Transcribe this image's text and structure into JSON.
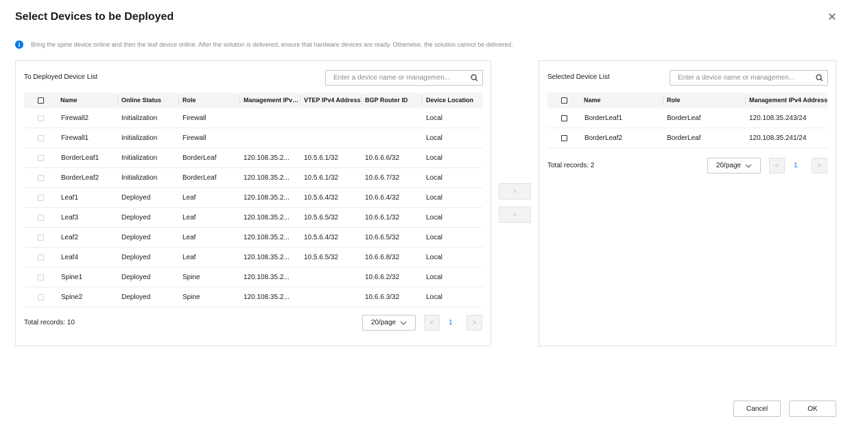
{
  "dialog": {
    "title": "Select Devices to be Deployed",
    "info_text": "Bring the spine device online and then the leaf device online. After the solution is delivered, ensure that hardware devices are ready. Otherwise, the solution cannot be delivered."
  },
  "left_panel": {
    "title": "To Deployed Device List",
    "search_placeholder": "Enter a device name or managemen...",
    "columns": [
      "Name",
      "Online Status",
      "Role",
      "Management IPv4...",
      "VTEP IPv4 Address",
      "BGP Router ID",
      "Device Location"
    ],
    "rows": [
      [
        "Firewall2",
        "Initialization",
        "Firewall",
        "",
        "",
        "",
        "Local"
      ],
      [
        "Firewall1",
        "Initialization",
        "Firewall",
        "",
        "",
        "",
        "Local"
      ],
      [
        "BorderLeaf1",
        "Initialization",
        "BorderLeaf",
        "120.108.35.2...",
        "10.5.6.1/32",
        "10.6.6.6/32",
        "Local"
      ],
      [
        "BorderLeaf2",
        "Initialization",
        "BorderLeaf",
        "120.108.35.2...",
        "10.5.6.1/32",
        "10.6.6.7/32",
        "Local"
      ],
      [
        "Leaf1",
        "Deployed",
        "Leaf",
        "120.108.35.2...",
        "10.5.6.4/32",
        "10.6.6.4/32",
        "Local"
      ],
      [
        "Leaf3",
        "Deployed",
        "Leaf",
        "120.108.35.2...",
        "10.5.6.5/32",
        "10.6.6.1/32",
        "Local"
      ],
      [
        "Leaf2",
        "Deployed",
        "Leaf",
        "120.108.35.2...",
        "10.5.6.4/32",
        "10.6.6.5/32",
        "Local"
      ],
      [
        "Leaf4",
        "Deployed",
        "Leaf",
        "120.108.35.2...",
        "10.5.6.5/32",
        "10.6.6.8/32",
        "Local"
      ],
      [
        "Spine1",
        "Deployed",
        "Spine",
        "120.108.35.2...",
        "",
        "10.6.6.2/32",
        "Local"
      ],
      [
        "Spine2",
        "Deployed",
        "Spine",
        "120.108.35.2...",
        "",
        "10.6.6.3/32",
        "Local"
      ]
    ],
    "total_records": "Total records: 10",
    "page_size": "20/page",
    "current_page": "1"
  },
  "transfer": {
    "to_right": ">",
    "to_left": "<"
  },
  "right_panel": {
    "title": "Selected Device List",
    "search_placeholder": "Enter a device name or managemen...",
    "columns": [
      "Name",
      "Role",
      "Management IPv4 Address"
    ],
    "rows": [
      [
        "BorderLeaf1",
        "BorderLeaf",
        "120.108.35.243/24"
      ],
      [
        "BorderLeaf2",
        "BorderLeaf",
        "120.108.35.241/24"
      ]
    ],
    "total_records": "Total records: 2",
    "page_size": "20/page",
    "current_page": "1"
  },
  "buttons": {
    "cancel": "Cancel",
    "ok": "OK"
  },
  "colors": {
    "accent": "#0077e6",
    "border": "#dfe1e6",
    "header_bg": "#f5f5f5"
  },
  "icons": {
    "close": "close-icon",
    "info": "info-icon",
    "search": "search-icon",
    "page_size": "chevron-down-icon"
  }
}
